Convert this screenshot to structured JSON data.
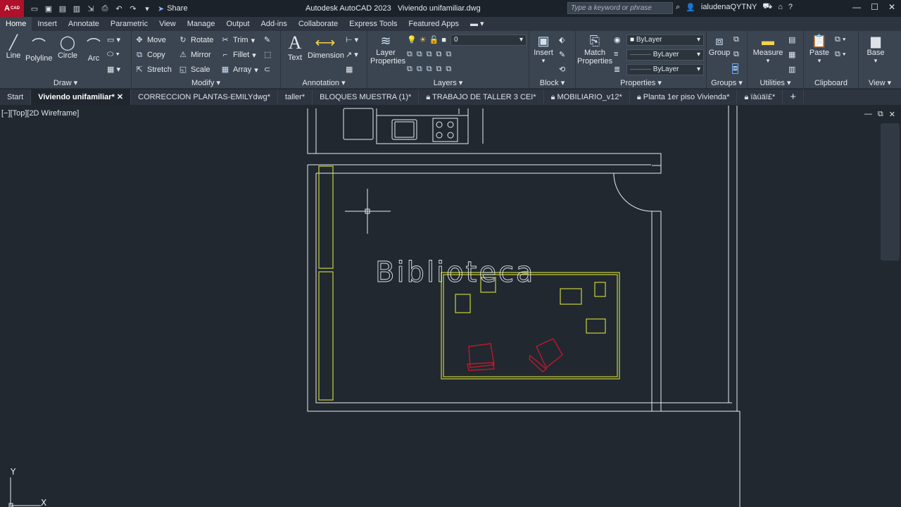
{
  "app": {
    "logo": "A",
    "logo_sub": "CAD",
    "title": "Autodesk AutoCAD 2023",
    "document": "Viviendo unifamiliar.dwg",
    "share_label": "Share",
    "search_placeholder": "Type a keyword or phrase",
    "user": "ialudenaQYTNY"
  },
  "menu_tabs": [
    "Home",
    "Insert",
    "Annotate",
    "Parametric",
    "View",
    "Manage",
    "Output",
    "Add-ins",
    "Collaborate",
    "Express Tools",
    "Featured Apps"
  ],
  "ribbon": {
    "draw": {
      "title": "Draw",
      "line": "Line",
      "polyline": "Polyline",
      "circle": "Circle",
      "arc": "Arc"
    },
    "modify": {
      "title": "Modify",
      "move": "Move",
      "rotate": "Rotate",
      "trim": "Trim",
      "copy": "Copy",
      "mirror": "Mirror",
      "fillet": "Fillet",
      "stretch": "Stretch",
      "scale": "Scale",
      "array": "Array"
    },
    "annotation": {
      "title": "Annotation",
      "text": "Text",
      "dimension": "Dimension"
    },
    "layers": {
      "title": "Layers",
      "layer_properties_1": "Layer",
      "layer_properties_2": "Properties",
      "current_layer": "0"
    },
    "block": {
      "title": "Block",
      "insert": "Insert"
    },
    "properties": {
      "title": "Properties",
      "match_1": "Match",
      "match_2": "Properties",
      "color": "ByLayer",
      "linetype": "ByLayer",
      "lineweight": "ByLayer"
    },
    "groups": {
      "title": "Groups",
      "group": "Group"
    },
    "utilities": {
      "title": "Utilities",
      "measure": "Measure"
    },
    "clipboard": {
      "title": "Clipboard",
      "paste": "Paste"
    },
    "view": {
      "title": "View",
      "base": "Base"
    }
  },
  "doc_tabs": [
    "Start",
    "Viviendo unifamiliar*",
    "CORRECCION PLANTAS-EMILYdwg*",
    "taller*",
    "BLOQUES MUESTRA (1)*",
    "TRABAJO DE TALLER 3 CEI*",
    "MOBILIARIO_v12*",
    "Planta 1er piso Vivienda*",
    "ïàüäï£*"
  ],
  "viewport": {
    "label": "[−][Top][2D Wireframe]",
    "room_label": "Biblioteca",
    "ucs_y": "Y",
    "ucs_x": "X"
  },
  "colors": {
    "ribbon_bg": "#3b4551",
    "viewport_bg": "#212830",
    "wall_line": "#e8ecef",
    "furniture_yellow": "#c8d23a",
    "chair_red": "#c0182a"
  }
}
